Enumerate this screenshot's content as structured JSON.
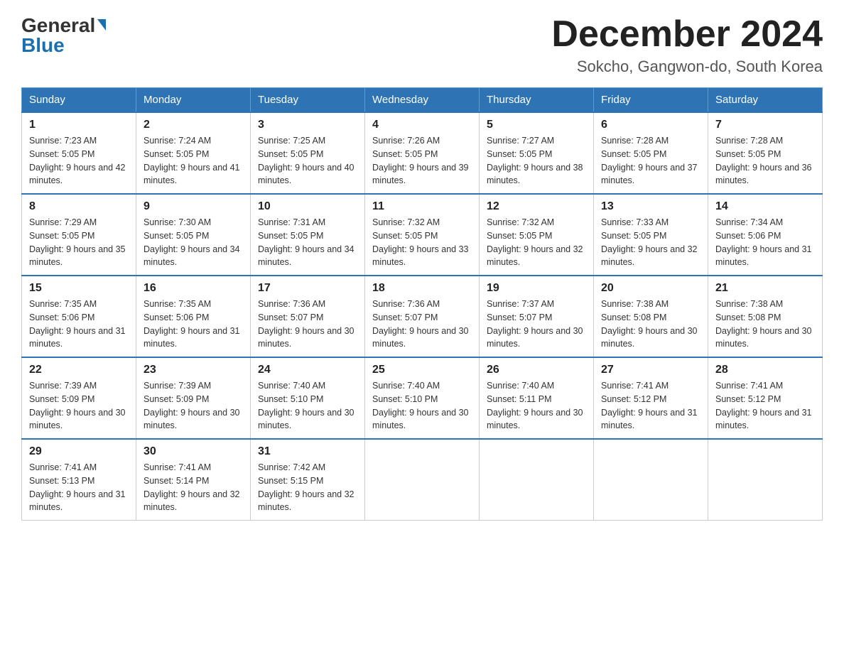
{
  "logo": {
    "line1": "General",
    "line2": "Blue"
  },
  "header": {
    "month": "December 2024",
    "location": "Sokcho, Gangwon-do, South Korea"
  },
  "days_of_week": [
    "Sunday",
    "Monday",
    "Tuesday",
    "Wednesday",
    "Thursday",
    "Friday",
    "Saturday"
  ],
  "weeks": [
    [
      {
        "day": "1",
        "sunrise": "7:23 AM",
        "sunset": "5:05 PM",
        "daylight": "9 hours and 42 minutes."
      },
      {
        "day": "2",
        "sunrise": "7:24 AM",
        "sunset": "5:05 PM",
        "daylight": "9 hours and 41 minutes."
      },
      {
        "day": "3",
        "sunrise": "7:25 AM",
        "sunset": "5:05 PM",
        "daylight": "9 hours and 40 minutes."
      },
      {
        "day": "4",
        "sunrise": "7:26 AM",
        "sunset": "5:05 PM",
        "daylight": "9 hours and 39 minutes."
      },
      {
        "day": "5",
        "sunrise": "7:27 AM",
        "sunset": "5:05 PM",
        "daylight": "9 hours and 38 minutes."
      },
      {
        "day": "6",
        "sunrise": "7:28 AM",
        "sunset": "5:05 PM",
        "daylight": "9 hours and 37 minutes."
      },
      {
        "day": "7",
        "sunrise": "7:28 AM",
        "sunset": "5:05 PM",
        "daylight": "9 hours and 36 minutes."
      }
    ],
    [
      {
        "day": "8",
        "sunrise": "7:29 AM",
        "sunset": "5:05 PM",
        "daylight": "9 hours and 35 minutes."
      },
      {
        "day": "9",
        "sunrise": "7:30 AM",
        "sunset": "5:05 PM",
        "daylight": "9 hours and 34 minutes."
      },
      {
        "day": "10",
        "sunrise": "7:31 AM",
        "sunset": "5:05 PM",
        "daylight": "9 hours and 34 minutes."
      },
      {
        "day": "11",
        "sunrise": "7:32 AM",
        "sunset": "5:05 PM",
        "daylight": "9 hours and 33 minutes."
      },
      {
        "day": "12",
        "sunrise": "7:32 AM",
        "sunset": "5:05 PM",
        "daylight": "9 hours and 32 minutes."
      },
      {
        "day": "13",
        "sunrise": "7:33 AM",
        "sunset": "5:05 PM",
        "daylight": "9 hours and 32 minutes."
      },
      {
        "day": "14",
        "sunrise": "7:34 AM",
        "sunset": "5:06 PM",
        "daylight": "9 hours and 31 minutes."
      }
    ],
    [
      {
        "day": "15",
        "sunrise": "7:35 AM",
        "sunset": "5:06 PM",
        "daylight": "9 hours and 31 minutes."
      },
      {
        "day": "16",
        "sunrise": "7:35 AM",
        "sunset": "5:06 PM",
        "daylight": "9 hours and 31 minutes."
      },
      {
        "day": "17",
        "sunrise": "7:36 AM",
        "sunset": "5:07 PM",
        "daylight": "9 hours and 30 minutes."
      },
      {
        "day": "18",
        "sunrise": "7:36 AM",
        "sunset": "5:07 PM",
        "daylight": "9 hours and 30 minutes."
      },
      {
        "day": "19",
        "sunrise": "7:37 AM",
        "sunset": "5:07 PM",
        "daylight": "9 hours and 30 minutes."
      },
      {
        "day": "20",
        "sunrise": "7:38 AM",
        "sunset": "5:08 PM",
        "daylight": "9 hours and 30 minutes."
      },
      {
        "day": "21",
        "sunrise": "7:38 AM",
        "sunset": "5:08 PM",
        "daylight": "9 hours and 30 minutes."
      }
    ],
    [
      {
        "day": "22",
        "sunrise": "7:39 AM",
        "sunset": "5:09 PM",
        "daylight": "9 hours and 30 minutes."
      },
      {
        "day": "23",
        "sunrise": "7:39 AM",
        "sunset": "5:09 PM",
        "daylight": "9 hours and 30 minutes."
      },
      {
        "day": "24",
        "sunrise": "7:40 AM",
        "sunset": "5:10 PM",
        "daylight": "9 hours and 30 minutes."
      },
      {
        "day": "25",
        "sunrise": "7:40 AM",
        "sunset": "5:10 PM",
        "daylight": "9 hours and 30 minutes."
      },
      {
        "day": "26",
        "sunrise": "7:40 AM",
        "sunset": "5:11 PM",
        "daylight": "9 hours and 30 minutes."
      },
      {
        "day": "27",
        "sunrise": "7:41 AM",
        "sunset": "5:12 PM",
        "daylight": "9 hours and 31 minutes."
      },
      {
        "day": "28",
        "sunrise": "7:41 AM",
        "sunset": "5:12 PM",
        "daylight": "9 hours and 31 minutes."
      }
    ],
    [
      {
        "day": "29",
        "sunrise": "7:41 AM",
        "sunset": "5:13 PM",
        "daylight": "9 hours and 31 minutes."
      },
      {
        "day": "30",
        "sunrise": "7:41 AM",
        "sunset": "5:14 PM",
        "daylight": "9 hours and 32 minutes."
      },
      {
        "day": "31",
        "sunrise": "7:42 AM",
        "sunset": "5:15 PM",
        "daylight": "9 hours and 32 minutes."
      },
      null,
      null,
      null,
      null
    ]
  ]
}
